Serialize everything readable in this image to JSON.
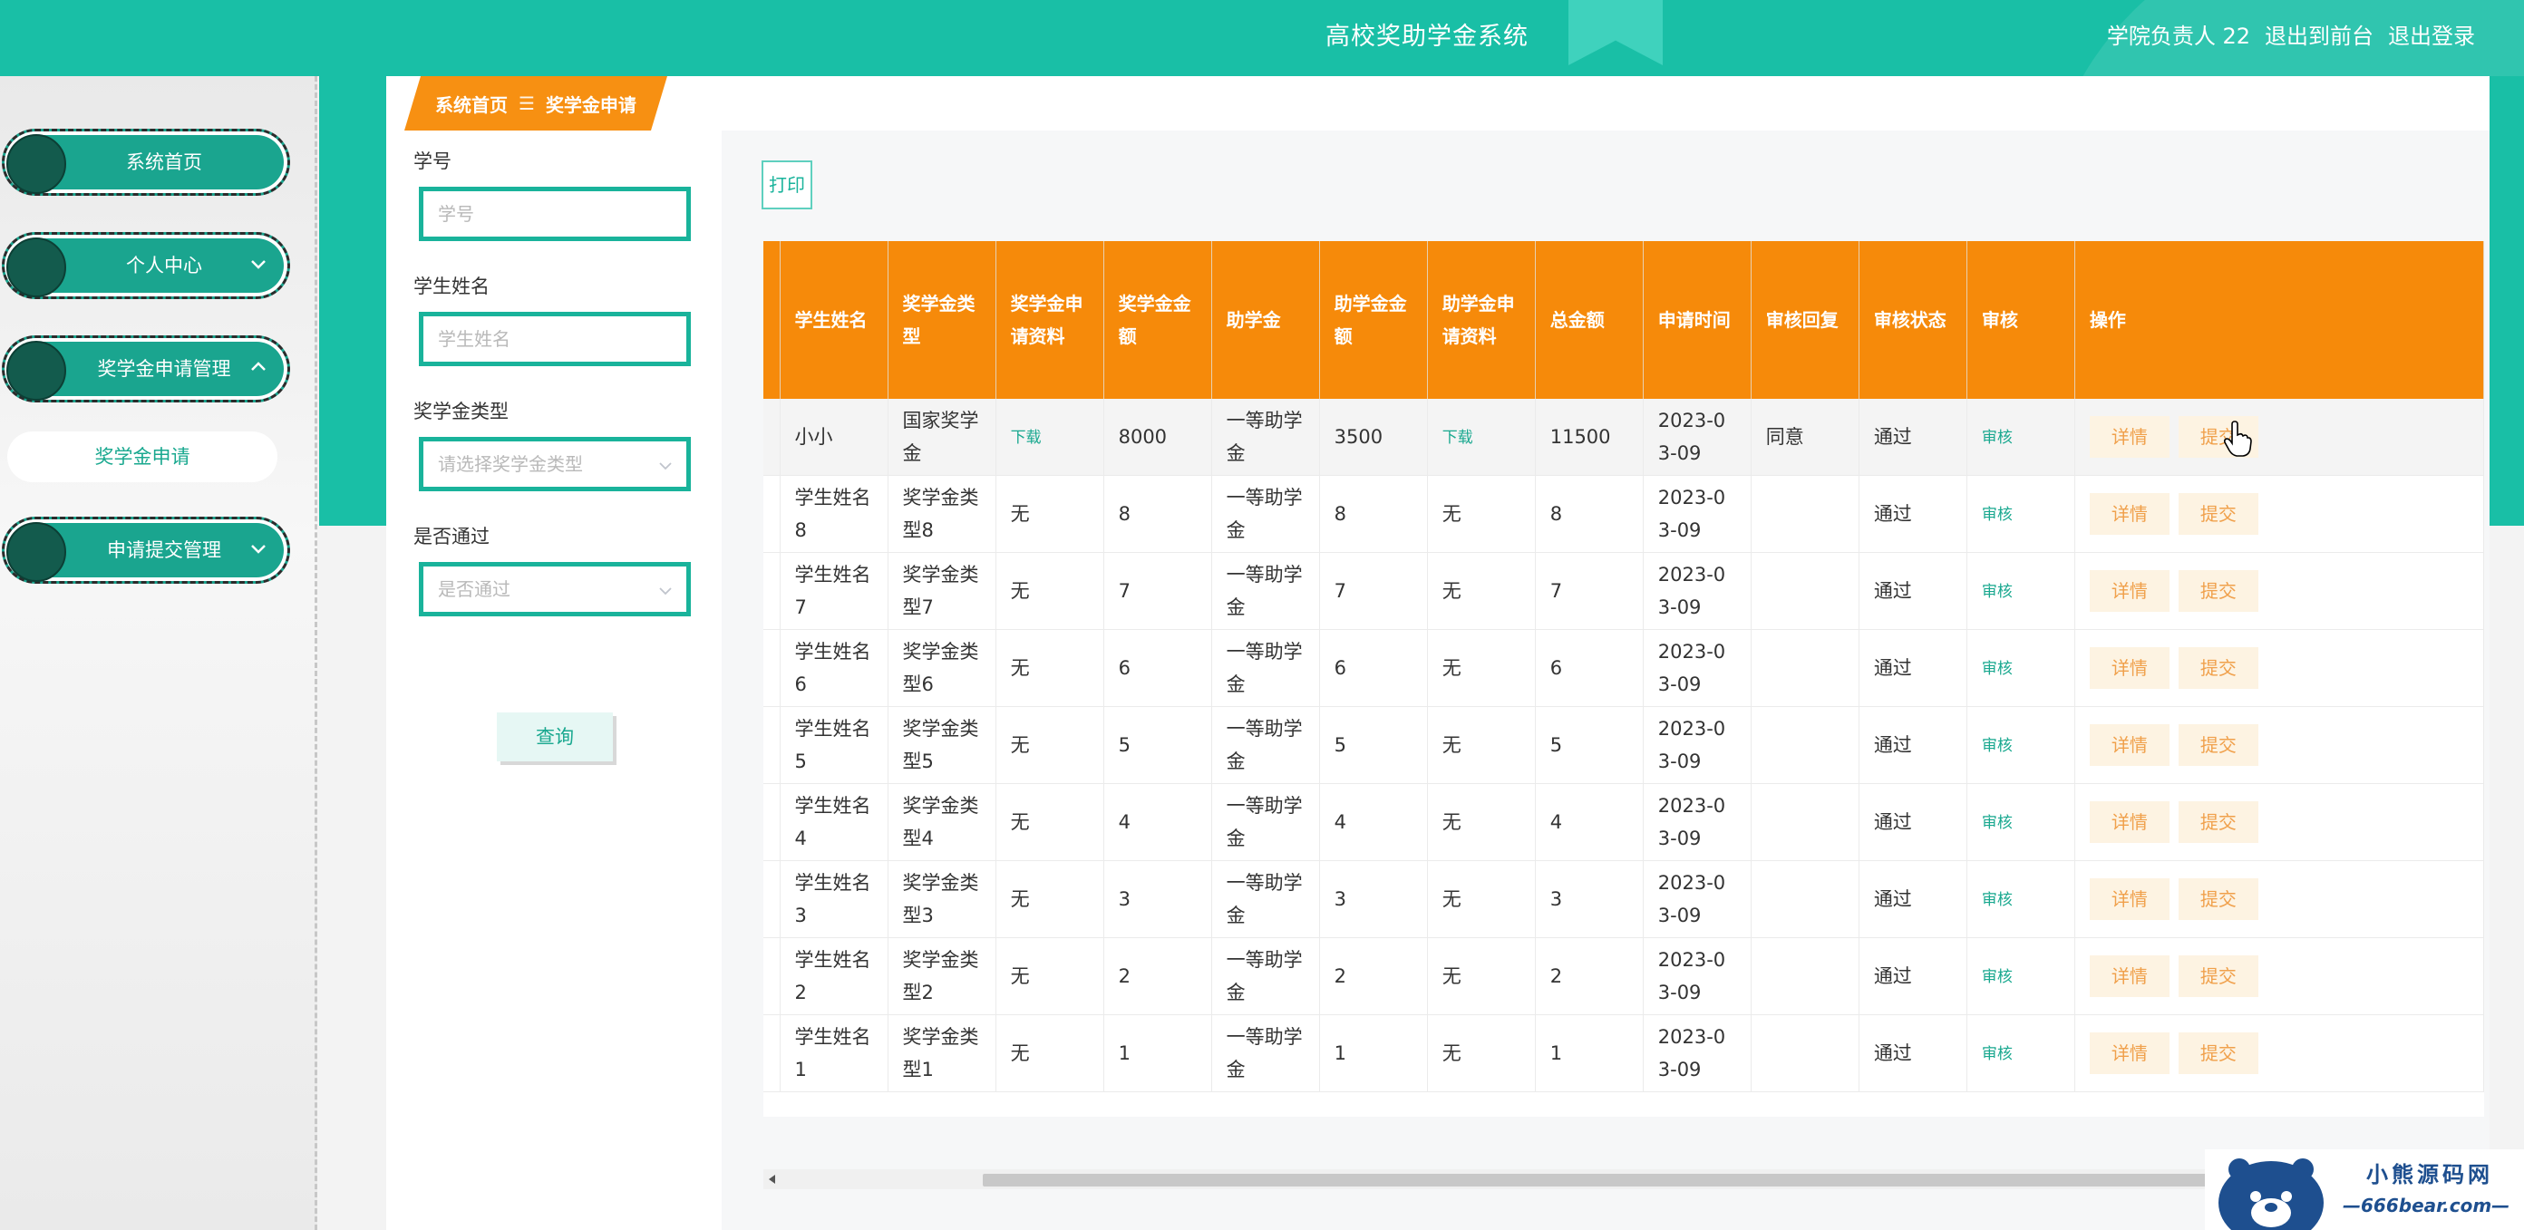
{
  "header": {
    "title": "高校奖助学金系统",
    "user": "学院负责人 22",
    "back_link": "退出到前台",
    "logout_link": "退出登录"
  },
  "sidebar": {
    "items": [
      {
        "label": "系统首页"
      },
      {
        "label": "个人中心"
      },
      {
        "label": "奖学金申请管理"
      },
      {
        "label": "申请提交管理"
      }
    ],
    "subitem": "奖学金申请"
  },
  "breadcrumb": {
    "home": "系统首页",
    "separator": "☰",
    "current": "奖学金申请"
  },
  "filters": {
    "student_id_label": "学号",
    "student_id_placeholder": "学号",
    "student_name_label": "学生姓名",
    "student_name_placeholder": "学生姓名",
    "type_label": "奖学金类型",
    "type_placeholder": "请选择奖学金类型",
    "pass_label": "是否通过",
    "pass_placeholder": "是否通过",
    "query_button": "查询"
  },
  "toolbar": {
    "print_button": "打印"
  },
  "table": {
    "headers": [
      "学生姓名",
      "奖学金类型",
      "奖学金申请资料",
      "奖学金金额",
      "助学金",
      "助学金金额",
      "助学金申请资料",
      "总金额",
      "申请时间",
      "审核回复",
      "审核状态",
      "审核",
      "操作"
    ],
    "rows": [
      {
        "name": "小小",
        "type": "国家奖学金",
        "s_doc": "下载",
        "s_amt": "8000",
        "grant": "一等助学金",
        "g_amt": "3500",
        "g_doc": "下载",
        "total": "11500",
        "time": "2023-03-09",
        "reply": "同意",
        "status": "通过",
        "audit": "审核"
      },
      {
        "name": "学生姓名8",
        "type": "奖学金类型8",
        "s_doc": "无",
        "s_amt": "8",
        "grant": "一等助学金",
        "g_amt": "8",
        "g_doc": "无",
        "total": "8",
        "time": "2023-03-09",
        "reply": "",
        "status": "通过",
        "audit": "审核"
      },
      {
        "name": "学生姓名7",
        "type": "奖学金类型7",
        "s_doc": "无",
        "s_amt": "7",
        "grant": "一等助学金",
        "g_amt": "7",
        "g_doc": "无",
        "total": "7",
        "time": "2023-03-09",
        "reply": "",
        "status": "通过",
        "audit": "审核"
      },
      {
        "name": "学生姓名6",
        "type": "奖学金类型6",
        "s_doc": "无",
        "s_amt": "6",
        "grant": "一等助学金",
        "g_amt": "6",
        "g_doc": "无",
        "total": "6",
        "time": "2023-03-09",
        "reply": "",
        "status": "通过",
        "audit": "审核"
      },
      {
        "name": "学生姓名5",
        "type": "奖学金类型5",
        "s_doc": "无",
        "s_amt": "5",
        "grant": "一等助学金",
        "g_amt": "5",
        "g_doc": "无",
        "total": "5",
        "time": "2023-03-09",
        "reply": "",
        "status": "通过",
        "audit": "审核"
      },
      {
        "name": "学生姓名4",
        "type": "奖学金类型4",
        "s_doc": "无",
        "s_amt": "4",
        "grant": "一等助学金",
        "g_amt": "4",
        "g_doc": "无",
        "total": "4",
        "time": "2023-03-09",
        "reply": "",
        "status": "通过",
        "audit": "审核"
      },
      {
        "name": "学生姓名3",
        "type": "奖学金类型3",
        "s_doc": "无",
        "s_amt": "3",
        "grant": "一等助学金",
        "g_amt": "3",
        "g_doc": "无",
        "total": "3",
        "time": "2023-03-09",
        "reply": "",
        "status": "通过",
        "audit": "审核"
      },
      {
        "name": "学生姓名2",
        "type": "奖学金类型2",
        "s_doc": "无",
        "s_amt": "2",
        "grant": "一等助学金",
        "g_amt": "2",
        "g_doc": "无",
        "total": "2",
        "time": "2023-03-09",
        "reply": "",
        "status": "通过",
        "audit": "审核"
      },
      {
        "name": "学生姓名1",
        "type": "奖学金类型1",
        "s_doc": "无",
        "s_amt": "1",
        "grant": "一等助学金",
        "g_amt": "1",
        "g_doc": "无",
        "total": "1",
        "time": "2023-03-09",
        "reply": "",
        "status": "通过",
        "audit": "审核"
      }
    ],
    "detail_button": "详情",
    "submit_button": "提交"
  },
  "watermark": {
    "cn": "小熊源码网",
    "en": "—666bear.com—"
  },
  "colors": {
    "primary": "#19bfa6",
    "header_orange": "#f68a0a",
    "sidebar_item": "#1aa58f",
    "button_text_orange": "#f0a04b"
  },
  "icons": {
    "chevron": "chevron-down-icon",
    "chevron_up": "chevron-up-icon",
    "cursor": "hand-cursor-icon",
    "logo": "bear-logo-icon"
  }
}
